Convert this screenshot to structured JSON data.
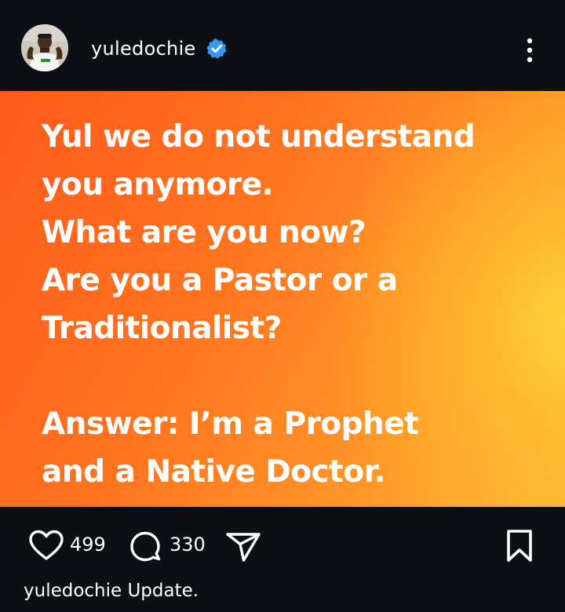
{
  "header": {
    "username": "yuledochie",
    "avatar_icon": "avatar",
    "verified_icon": "verified-badge-icon",
    "more_icon": "more-options-icon",
    "verified_color": "#3897f0"
  },
  "post": {
    "text": "Yul we do not understand\nyou anymore.\nWhat are you now?\nAre you a Pastor or a\nTraditionalist?\n\nAnswer: I’m a Prophet\nand a Native Doctor.",
    "gradient_colors": [
      "#ff5a1c",
      "#ff9628",
      "#ffd63e"
    ]
  },
  "actions": {
    "likes": "499",
    "comments": "330",
    "like_icon": "heart-icon",
    "comment_icon": "comment-icon",
    "share_icon": "share-icon",
    "save_icon": "bookmark-icon"
  },
  "caption": "yuledochie Update."
}
